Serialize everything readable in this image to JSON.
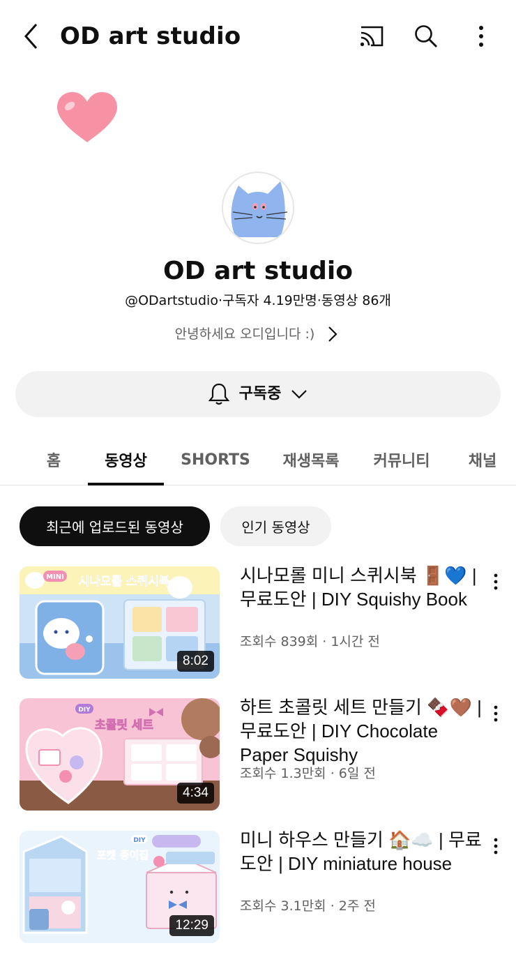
{
  "header": {
    "title": "OD art studio",
    "back_icon": "back-icon",
    "cast_icon": "cast-icon",
    "search_icon": "search-icon",
    "more_icon": "more-vertical-icon"
  },
  "channel": {
    "name": "OD art studio",
    "meta": "@ODartstudio·구독자 4.19만명·동영상 86개",
    "description": "안녕하세요 오디입니다 :)"
  },
  "subscribe": {
    "label": "구독중"
  },
  "tabs": [
    {
      "label": "홈"
    },
    {
      "label": "동영상"
    },
    {
      "label": "SHORTS"
    },
    {
      "label": "재생목록"
    },
    {
      "label": "커뮤니티"
    },
    {
      "label": "채널"
    }
  ],
  "filters": {
    "recent": "최근에 업로드된 동영상",
    "popular": "인기 동영상"
  },
  "videos": [
    {
      "title": "시나모롤 미니 스퀴시북 🚪💙 | 무료도안 | DIY Squishy Book",
      "meta": "조회수 839회 · 1시간 전",
      "duration": "8:02",
      "thumb_text": "시나모롤 스퀴시북",
      "thumb_badge": "MINI"
    },
    {
      "title": "하트 초콜릿 세트 만들기 🍫🤎 | 무료도안 | DIY Chocolate Paper Squishy",
      "meta": "조회수 1.3만회 · 6일 전",
      "duration": "4:34",
      "thumb_text": "초콜릿 세트",
      "thumb_badge": "DIY"
    },
    {
      "title": "미니 하우스 만들기 🏠☁️ | 무료도안 | DIY miniature house",
      "meta": "조회수 3.1만회 · 2주 전",
      "duration": "12:29",
      "thumb_text": "포켓 종이집",
      "thumb_badge": "DIY"
    }
  ],
  "colors": {
    "accent": "#0f0f0f",
    "secondary_text": "#606060",
    "chip_bg": "#f2f2f2",
    "heart": "#f792a5",
    "avatar_cat": "#8fb4ee"
  }
}
